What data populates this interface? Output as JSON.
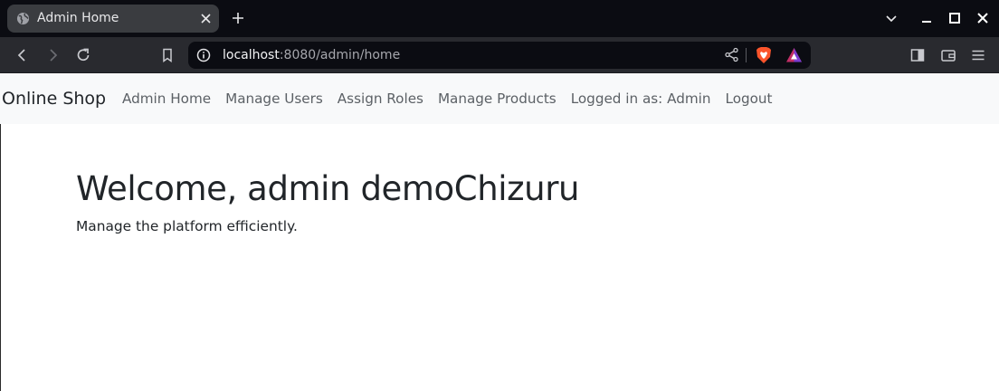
{
  "browser": {
    "tab": {
      "title": "Admin Home"
    },
    "url": {
      "host": "localhost",
      "rest": ":8080/admin/home"
    },
    "colors": {
      "titlebar": "#0b0c12",
      "toolbar": "#292a2f",
      "tab": "#3a3c40"
    }
  },
  "navbar": {
    "brand": "Online Shop",
    "links": [
      {
        "label": "Admin Home"
      },
      {
        "label": "Manage Users"
      },
      {
        "label": "Assign Roles"
      },
      {
        "label": "Manage Products"
      },
      {
        "label": "Logged in as: Admin"
      },
      {
        "label": "Logout"
      }
    ]
  },
  "main": {
    "heading": "Welcome, admin demoChizuru",
    "subtitle": "Manage the platform efficiently."
  },
  "icons": {
    "tab": [
      "globe-icon",
      "close-icon",
      "plus-icon"
    ],
    "window": [
      "chevron-down-icon",
      "minimize-icon",
      "maximize-icon",
      "close-window-icon"
    ],
    "toolbar": [
      "back-icon",
      "forward-icon",
      "reload-icon",
      "bookmark-icon",
      "info-icon",
      "share-icon",
      "brave-shields-icon",
      "brave-rewards-icon",
      "sidebar-icon",
      "wallet-icon",
      "menu-icon"
    ]
  }
}
